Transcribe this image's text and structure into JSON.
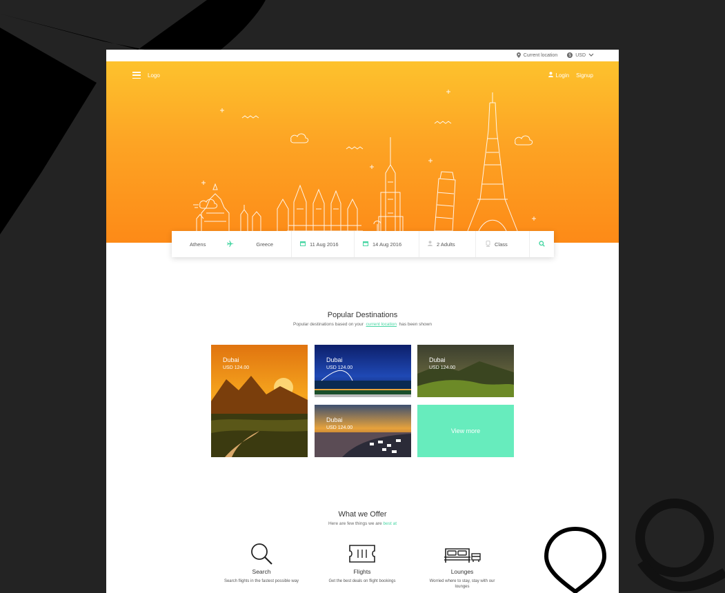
{
  "topbar": {
    "location": "Current location",
    "currency": "USD"
  },
  "nav": {
    "logo": "Logo",
    "login": "Login",
    "signup": "Signup"
  },
  "search": {
    "from": "Athens",
    "to": "Greece",
    "depart": "11 Aug 2016",
    "return": "14 Aug 2016",
    "travellers": "2 Adults",
    "class": "Class"
  },
  "popular": {
    "title": "Popular Destinations",
    "subtitle_pre": "Popular destinations based on your",
    "subtitle_link": "current location",
    "subtitle_post": "has been shown",
    "tiles": [
      {
        "city": "Dubai",
        "price": "USD 124.00"
      },
      {
        "city": "Dubai",
        "price": "USD 124.00"
      },
      {
        "city": "Dubai",
        "price": "USD 124.00"
      },
      {
        "city": "Dubai",
        "price": "USD 124.00"
      }
    ],
    "view_more": "View more"
  },
  "offer": {
    "title": "What we Offer",
    "subtitle_pre": "Here are few things we are",
    "subtitle_link": "best at",
    "items": [
      {
        "icon": "search-icon",
        "title": "Search",
        "desc": "Search flights in the fastest possible way"
      },
      {
        "icon": "ticket-icon",
        "title": "Flights",
        "desc": "Get the best deals on flight bookings"
      },
      {
        "icon": "bed-icon",
        "title": "Lounges",
        "desc": "Worried where to stay, stay with our lounges"
      }
    ]
  },
  "colors": {
    "accent": "#47d6a3",
    "hero_top": "#fdc22d",
    "hero_bottom": "#fd8a17",
    "tile_green": "#67ecbd"
  }
}
